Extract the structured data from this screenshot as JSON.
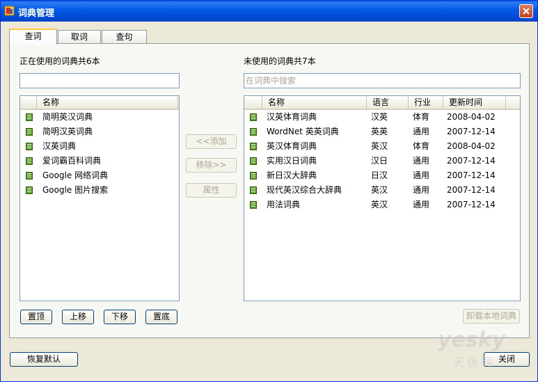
{
  "window": {
    "title": "词典管理"
  },
  "tabs": [
    {
      "label": "查词",
      "active": true
    },
    {
      "label": "取词",
      "active": false
    },
    {
      "label": "查句",
      "active": false
    }
  ],
  "left": {
    "caption": "正在使用的词典共6本",
    "filter_value": "",
    "columns": [
      "名称"
    ],
    "items": [
      "简明英汉词典",
      "简明汉英词典",
      "汉英词典",
      "爱词霸百科词典",
      "Google 网络词典",
      "Google 图片搜索"
    ]
  },
  "right": {
    "caption": "未使用的词典共7本",
    "search_placeholder": "在词典中搜索",
    "columns": [
      "名称",
      "语言",
      "行业",
      "更新时间"
    ],
    "rows": [
      {
        "name": "汉英体育词典",
        "lang": "汉英",
        "industry": "体育",
        "date": "2008-04-02"
      },
      {
        "name": "WordNet 英英词典",
        "lang": "英英",
        "industry": "通用",
        "date": "2007-12-14"
      },
      {
        "name": "英汉体育词典",
        "lang": "英汉",
        "industry": "体育",
        "date": "2008-04-02"
      },
      {
        "name": "实用汉日词典",
        "lang": "汉日",
        "industry": "通用",
        "date": "2007-12-14"
      },
      {
        "name": "新日汉大辞典",
        "lang": "日汉",
        "industry": "通用",
        "date": "2007-12-14"
      },
      {
        "name": "现代英汉综合大辞典",
        "lang": "英汉",
        "industry": "通用",
        "date": "2007-12-14"
      },
      {
        "name": "用法词典",
        "lang": "英汉",
        "industry": "通用",
        "date": "2007-12-14"
      }
    ]
  },
  "middle_buttons": {
    "add": "<<添加",
    "remove": "移除>>",
    "properties": "属性"
  },
  "order_buttons": {
    "top": "置顶",
    "up": "上移",
    "down": "下移",
    "bottom": "置底"
  },
  "uninstall_button": "卸载本地词典",
  "restore_button": "恢复默认",
  "close_button": "关闭",
  "watermark": {
    "line1": "yesky",
    "line2": "天极网"
  },
  "colors": {
    "titlebar": "#0054e3",
    "tab_highlight": "#ffc83c",
    "dictionary_icon": "#5a9a2a",
    "close_button": "#d9552c"
  }
}
